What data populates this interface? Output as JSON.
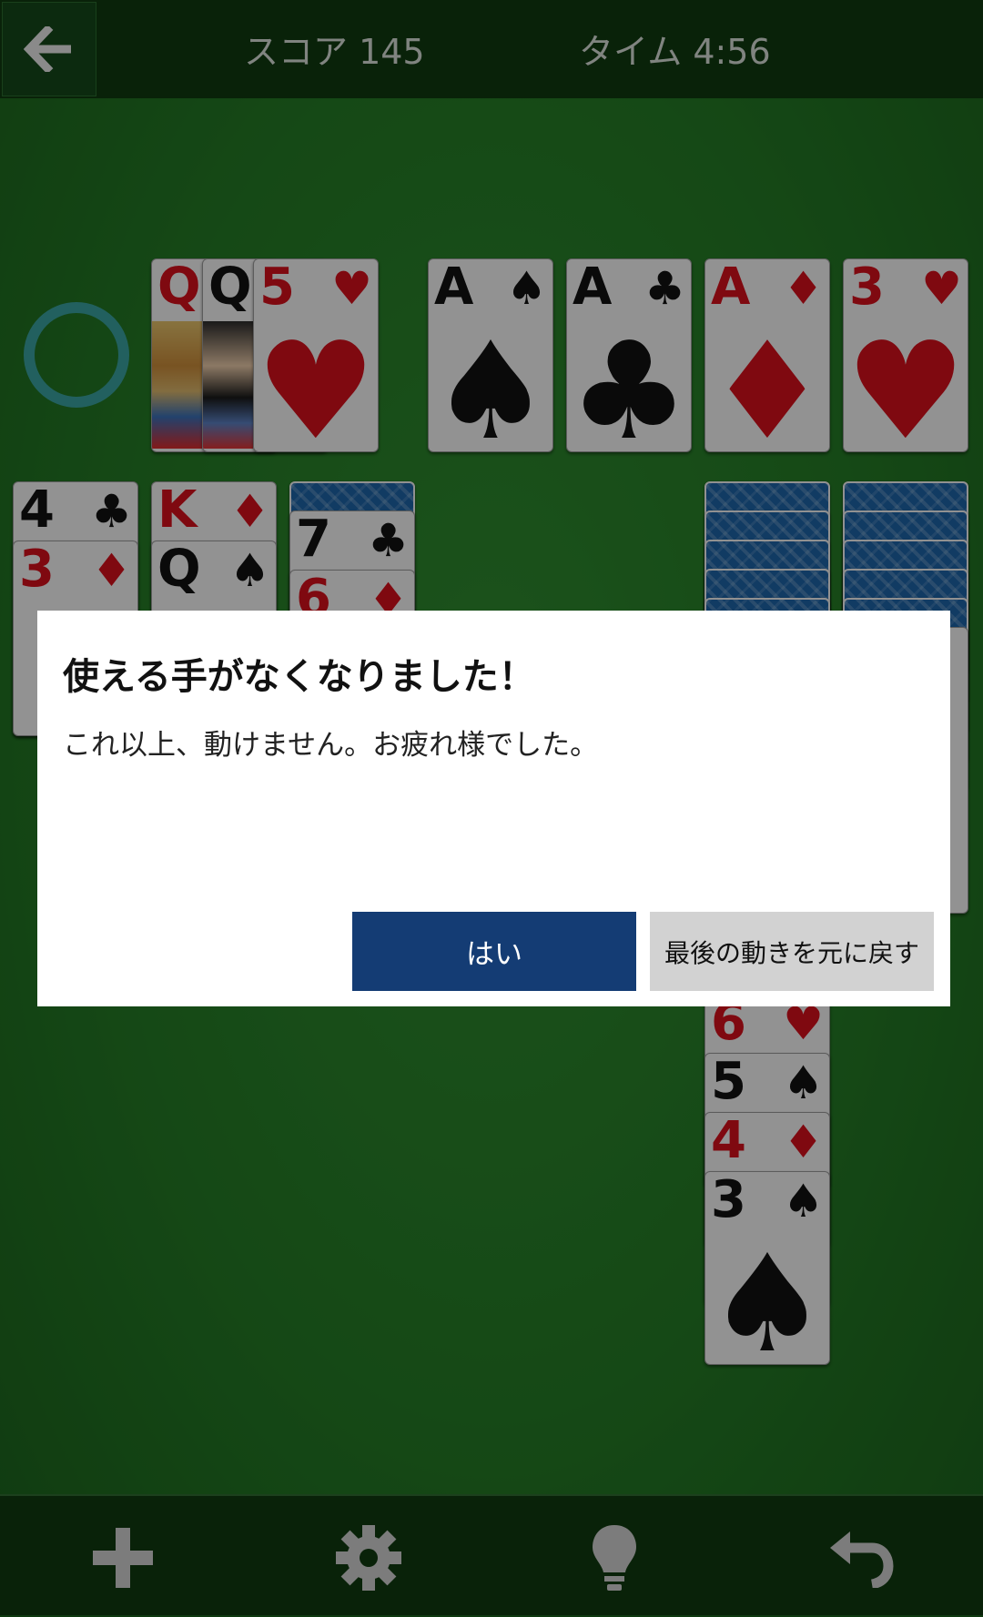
{
  "header": {
    "score_text": "スコア 145",
    "time_text": "タイム 4:56"
  },
  "icons": {
    "back": "arrow-left-icon",
    "new_game": "plus-icon",
    "settings": "gear-icon",
    "hint": "lightbulb-icon",
    "undo": "undo-icon",
    "empty_stock": "recycle-circle-icon"
  },
  "colors": {
    "felt": "#247a25",
    "bar": "#0f3a10",
    "primary_button": "#143c74",
    "secondary_button": "#d2d2d2",
    "red_suit": "#d4101c",
    "card_back": "#1d63a6"
  },
  "waste": [
    {
      "rank": "Q",
      "suit": "♥",
      "color": "red"
    },
    {
      "rank": "Q",
      "suit": "♠",
      "color": "black"
    },
    {
      "rank": "5",
      "suit": "♥",
      "color": "red"
    }
  ],
  "foundations": [
    {
      "rank": "A",
      "suit": "♠",
      "color": "black"
    },
    {
      "rank": "A",
      "suit": "♣",
      "color": "black"
    },
    {
      "rank": "A",
      "suit": "♦",
      "color": "red"
    },
    {
      "rank": "3",
      "suit": "♥",
      "color": "red"
    }
  ],
  "tableau": {
    "col1": [
      {
        "rank": "4",
        "suit": "♣",
        "color": "black"
      },
      {
        "rank": "3",
        "suit": "♦",
        "color": "red"
      }
    ],
    "col2": [
      {
        "rank": "K",
        "suit": "♦",
        "color": "red"
      },
      {
        "rank": "Q",
        "suit": "♠",
        "color": "black"
      }
    ],
    "col3": [
      {
        "rank": "7",
        "suit": "♣",
        "color": "black"
      },
      {
        "rank": "6",
        "suit": "♦",
        "color": "red"
      }
    ],
    "col6": [
      {
        "rank": "6",
        "suit": "♥",
        "color": "red"
      },
      {
        "rank": "5",
        "suit": "♠",
        "color": "black"
      },
      {
        "rank": "4",
        "suit": "♦",
        "color": "red"
      },
      {
        "rank": "3",
        "suit": "♠",
        "color": "black"
      }
    ]
  },
  "dialog": {
    "title": "使える手がなくなりました！",
    "message": "これ以上、動けません。お疲れ様でした。",
    "yes_label": "はい",
    "undo_label": "最後の動きを元に戻す"
  }
}
